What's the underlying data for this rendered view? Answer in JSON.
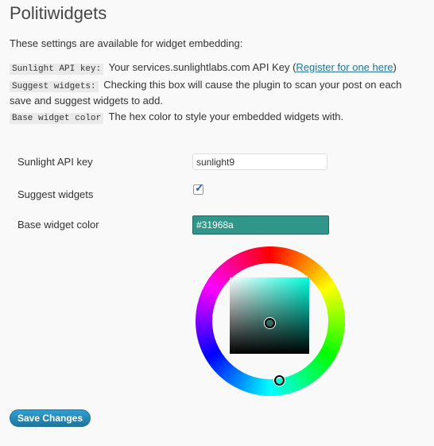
{
  "page": {
    "title": "Politiwidgets"
  },
  "intro": "These settings are available for widget embedding:",
  "descriptions": [
    {
      "code": "Sunlight API key:",
      "text_before": "Your services.sunlightlabs.com API Key (",
      "link": "Register for one here",
      "text_after": ")"
    },
    {
      "code": "Suggest widgets:",
      "text": "Checking this box will cause the plugin to scan your post on each save and suggest widgets to add."
    },
    {
      "code": "Base widget color",
      "text": "The hex color to style your embedded widgets with."
    }
  ],
  "form": {
    "api_key": {
      "label": "Sunlight API key",
      "value": "sunlight9"
    },
    "suggest": {
      "label": "Suggest widgets",
      "checked": true
    },
    "color": {
      "label": "Base widget color",
      "value": "#31968a"
    }
  },
  "colors": {
    "selected": "#31968a",
    "button": "#21759b"
  },
  "save_label": "Save Changes"
}
